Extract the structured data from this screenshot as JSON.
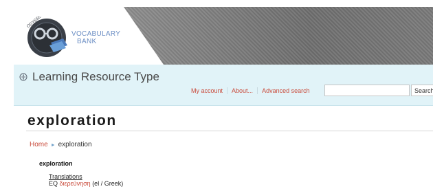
{
  "header": {
    "logo_text_line1": "VOCABULARY",
    "logo_text_line2": "BANK",
    "logo_ring_text": "ODYSSEUS",
    "site_title": "Learning Resource Type"
  },
  "topnav": {
    "my_account": "My account",
    "about": "About...",
    "advanced_search": "Advanced search"
  },
  "search": {
    "value": "",
    "placeholder": "",
    "button_label": "Search"
  },
  "main": {
    "page_title": "exploration",
    "breadcrumb": {
      "home": "Home",
      "separator": "►",
      "current": "exploration"
    },
    "term": "exploration",
    "translations_label": "Translations",
    "translation": {
      "code": "EQ",
      "word": "διερεύνηση",
      "language": "(el / Greek)"
    }
  },
  "colors": {
    "link": "#c94a3a",
    "titlebar_bg": "#e1f3f8",
    "banner": "#7a7a7a"
  }
}
